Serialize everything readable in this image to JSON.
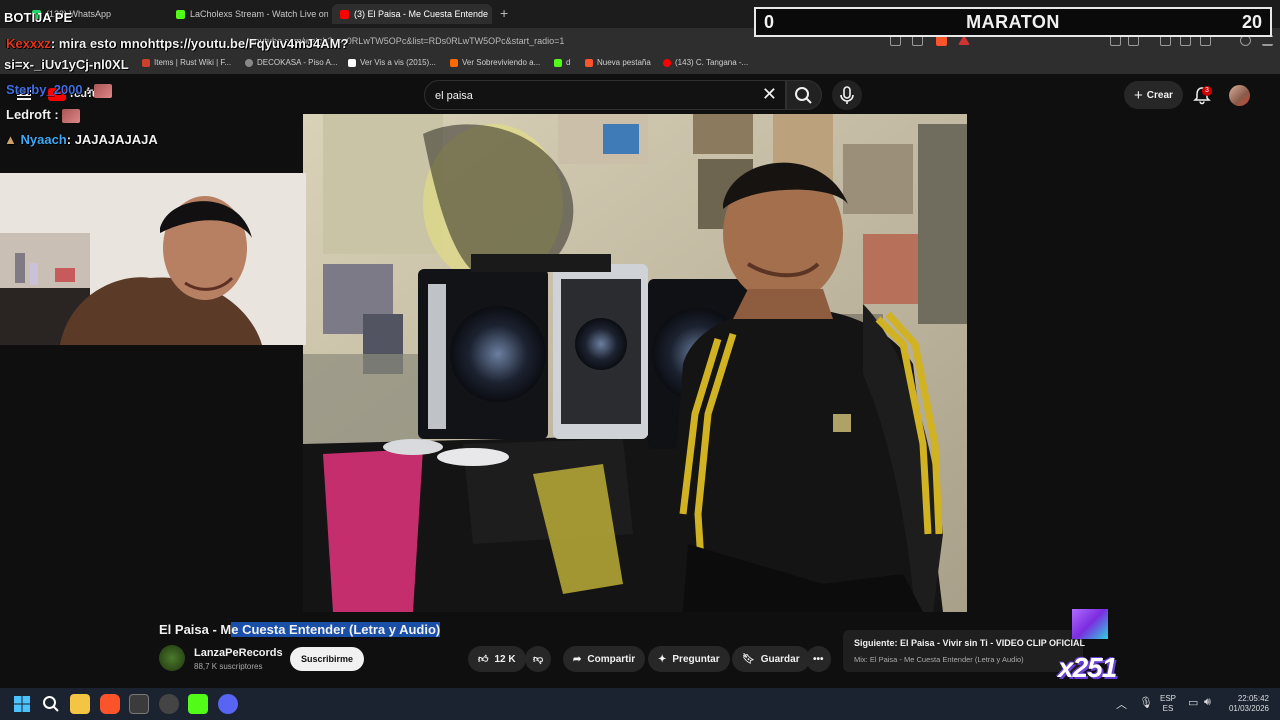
{
  "browser": {
    "tabs": [
      {
        "label": "(122) WhatsApp",
        "color": "#25d366"
      },
      {
        "label": "LaCholexs Stream - Watch Live on Ki",
        "color": "#53fc18"
      },
      {
        "label": "(3) El Paisa - Me Cuesta Entende",
        "color": "#ff0000"
      }
    ],
    "url": "youtube.com/watch?v=s0RLwTW5OPc&list=RDs0RLwTW5OPc&start_radio=1",
    "bookmarks": [
      {
        "label": "Items | Rust Wiki | F...",
        "color": "#cd412b"
      },
      {
        "label": "DECOKASA - Piso A...",
        "color": "#888888"
      },
      {
        "label": "Ver Vis a vis (2015)...",
        "color": "#ffffff"
      },
      {
        "label": "Ver Sobreviviendo a...",
        "color": "#ff6a00"
      },
      {
        "label": "d",
        "color": "#53fc18"
      },
      {
        "label": "Nueva pestaña",
        "color": "#fb542b"
      },
      {
        "label": "(143) C. Tangana -...",
        "color": "#ff0000"
      }
    ]
  },
  "youtube": {
    "logo_text": "YouTube",
    "search_value": "el paisa",
    "create_label": "Crear",
    "notifications_count": "3"
  },
  "overlay": {
    "score_left": "0",
    "score_title": "MARATON",
    "score_right": "20",
    "chat": [
      {
        "user": "BOTIJA PE",
        "text": "",
        "user_color": "#ffffff"
      },
      {
        "user": "Kexxxz",
        "text": ": mira esto mnohttps://youtu.be/Fqyuv4mJ4AM?",
        "user_color": "#e8331c"
      },
      {
        "user": "si=x-_iUv1yCj-nl0XL",
        "text": "",
        "user_color": "#ffffff"
      },
      {
        "user": "Sterby_2000",
        "text": ":",
        "user_color": "#3f6fe0"
      },
      {
        "user": "Ledroft",
        "text": ":",
        "user_color": "#ffffff"
      },
      {
        "user": "Nyaach",
        "text": ": JAJAJAJAJA",
        "user_color": "#3fa9f5"
      }
    ],
    "multiplier": "x251"
  },
  "video": {
    "title_plain": "El Paisa - M",
    "title_highlight": "e Cuesta Entender (Letra y Audio)",
    "channel": "LanzaPeRecords",
    "subscribers": "88,7 K suscriptores",
    "subscribe_label": "Suscribirme",
    "likes": "12 K",
    "share_label": "Compartir",
    "ask_label": "Preguntar",
    "save_label": "Guardar",
    "next_title": "Siguiente: El Paisa - Vivir sin Ti - VIDEO CLIP OFICIAL",
    "next_sub": "Mix: El Paisa - Me Cuesta Entender (Letra y Audio)"
  },
  "taskbar": {
    "lang_top": "ESP",
    "lang_bottom": "ES",
    "time": "22:05:42",
    "date": "01/03/2026"
  }
}
